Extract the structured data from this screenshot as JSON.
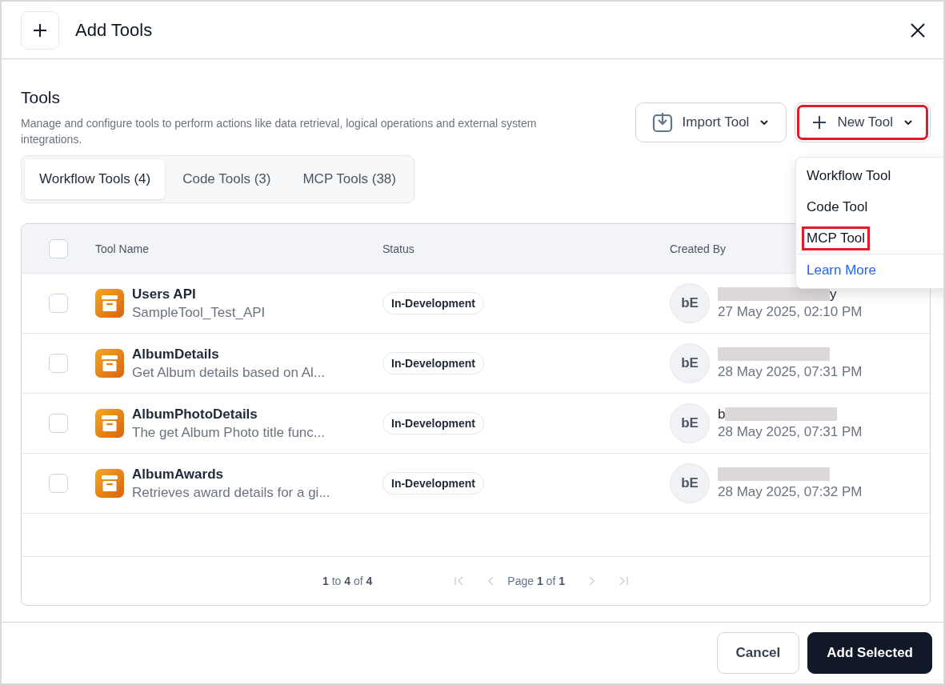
{
  "header": {
    "title": "Add Tools"
  },
  "section": {
    "title": "Tools",
    "description": "Manage and configure tools to perform actions like data retrieval, logical operations and external system integrations."
  },
  "actions": [
    {
      "kind": "import",
      "label": "Import Tool",
      "highlighted": false
    },
    {
      "kind": "new",
      "label": "New Tool",
      "highlighted": true
    }
  ],
  "menu": {
    "items": [
      {
        "label": "Workflow Tool",
        "kind": "option",
        "highlighted": false
      },
      {
        "label": "Code Tool",
        "kind": "option",
        "highlighted": false
      },
      {
        "label": "MCP Tool",
        "kind": "option",
        "highlighted": true
      },
      {
        "label": "Learn More",
        "kind": "link",
        "highlighted": false
      }
    ]
  },
  "tabs": [
    {
      "label": "Workflow Tools (4)",
      "selected": true
    },
    {
      "label": "Code Tools (3)",
      "selected": false
    },
    {
      "label": "MCP Tools (38)",
      "selected": false
    }
  ],
  "table": {
    "select_all_checked": false,
    "columns": [
      "Tool Name",
      "Status",
      "Created By"
    ],
    "rows": [
      {
        "checked": false,
        "name": "Users API",
        "description": "SampleTool_Test_API",
        "status": "In-Development",
        "avatar": "bE",
        "name_prefix": "",
        "name_suffix": "y",
        "date": "27 May 2025, 02:10 PM"
      },
      {
        "checked": false,
        "name": "AlbumDetails",
        "description": "Get Album details based on Al...",
        "status": "In-Development",
        "avatar": "bE",
        "name_prefix": "",
        "name_suffix": "",
        "date": "28 May 2025, 07:31 PM"
      },
      {
        "checked": false,
        "name": "AlbumPhotoDetails",
        "description": "The get Album Photo title func...",
        "status": "In-Development",
        "avatar": "bE",
        "name_prefix": "b",
        "name_suffix": "",
        "date": "28 May 2025, 07:31 PM"
      },
      {
        "checked": false,
        "name": "AlbumAwards",
        "description": "Retrieves award details for a gi...",
        "status": "In-Development",
        "avatar": "bE",
        "name_prefix": "",
        "name_suffix": "",
        "date": "28 May 2025, 07:32 PM"
      }
    ],
    "pagination": {
      "range": "**1** to **4** of **4**",
      "page": "Page **1** of **1**",
      "first_disabled": true,
      "prev_disabled": true,
      "next_disabled": true,
      "last_disabled": true
    }
  },
  "footer": {
    "buttons": [
      {
        "kind": "secondary",
        "label": "Cancel"
      },
      {
        "kind": "primary",
        "label": "Add Selected"
      }
    ]
  }
}
